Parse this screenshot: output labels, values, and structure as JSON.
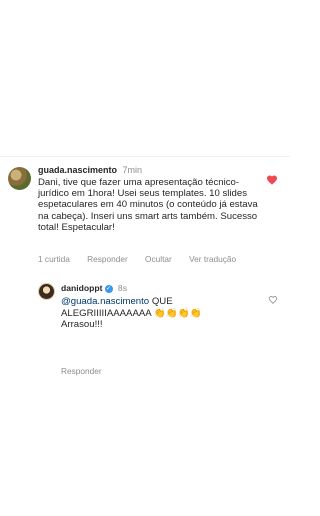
{
  "comment": {
    "username": "guada.nascimento",
    "time": "7min",
    "text": "Dani, tive que fazer uma apresentação técnico-jurídico em 1hora! Usei seus templates. 10 slides espetaculares em 40 minutos (o conteúdo já estava na cabeça). Inseri uns smart arts também. Sucesso total! Espetacular!",
    "likes_label": "1 curtida",
    "reply_label": "Responder",
    "hide_label": "Ocultar",
    "translate_label": "Ver tradução",
    "liked": true,
    "like_color": "#ed4956"
  },
  "reply": {
    "username": "danidoppt",
    "verified": true,
    "time": "8s",
    "mention": "@guada.nascimento",
    "text": " QUE ALEGRIIIIIAAAAAAA 👏👏👏👏 Arrasou!!!",
    "reply_label": "Responder",
    "liked": false
  },
  "colors": {
    "mention": "#00376b",
    "secondary_text": "#8e8e8e",
    "verified_badge": "#3897f0"
  }
}
